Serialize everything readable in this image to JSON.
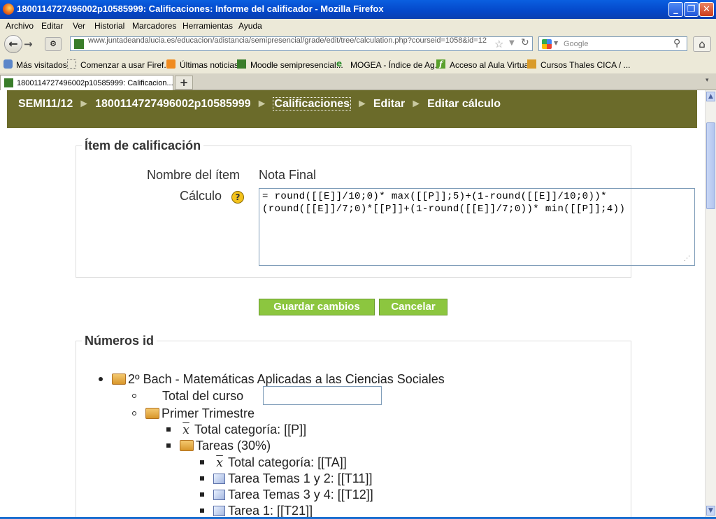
{
  "window": {
    "title": "1800114727496002p10585999: Calificaciones: Informe del calificador - Mozilla Firefox"
  },
  "menu": [
    "Archivo",
    "Editar",
    "Ver",
    "Historial",
    "Marcadores",
    "Herramientas",
    "Ayuda"
  ],
  "nav": {
    "url": "www.juntadeandalucia.es/educacion/adistancia/semipresencial/grade/edit/tree/calculation.php?courseid=1058&id=12",
    "url_domain": "juntadeandalucia.es",
    "search_placeholder": "Google"
  },
  "bookmarks": [
    "Más visitados",
    "Comenzar a usar Firef...",
    "Últimas noticias",
    "Moodle semipresencial...",
    "MOGEA - Índice de Ag...",
    "Acceso al Aula Virtual",
    "Cursos Thales CICA / ..."
  ],
  "tab": {
    "label": "1800114727496002p10585999: Calificacion..."
  },
  "breadcrumb": [
    "SEMI11/12",
    "1800114727496002p10585999",
    "Calificaciones",
    "Editar",
    "Editar cálculo"
  ],
  "form": {
    "section_title": "Ítem de calificación",
    "item_name_label": "Nombre del ítem",
    "item_name_value": "Nota Final",
    "calc_label": "Cálculo",
    "calc_value": "= round([[E]]/10;0)* max([[P]];5)+(1-round([[E]]/10;0))*(round([[E]]/7;0)*[[P]]+(1-round([[E]]/7;0))* min([[P]];4))",
    "save_label": "Guardar cambios",
    "cancel_label": "Cancelar"
  },
  "ids": {
    "section_title": "Números id",
    "course": "2º Bach - Matemáticas Aplicadas a las Ciencias Sociales",
    "total_label": "Total del curso",
    "total_value": "",
    "trimester": "Primer Trimestre",
    "total_cat": "Total categoría: [[P]]",
    "tareas": "Tareas (30%)",
    "total_cat_ta": "Total categoría: [[TA]]",
    "tarea_12": "Tarea Temas 1 y 2: [[T11]]",
    "tarea_34": "Tarea Temas 3 y 4: [[T12]]",
    "tarea_1": "Tarea 1: [[T21]]"
  }
}
